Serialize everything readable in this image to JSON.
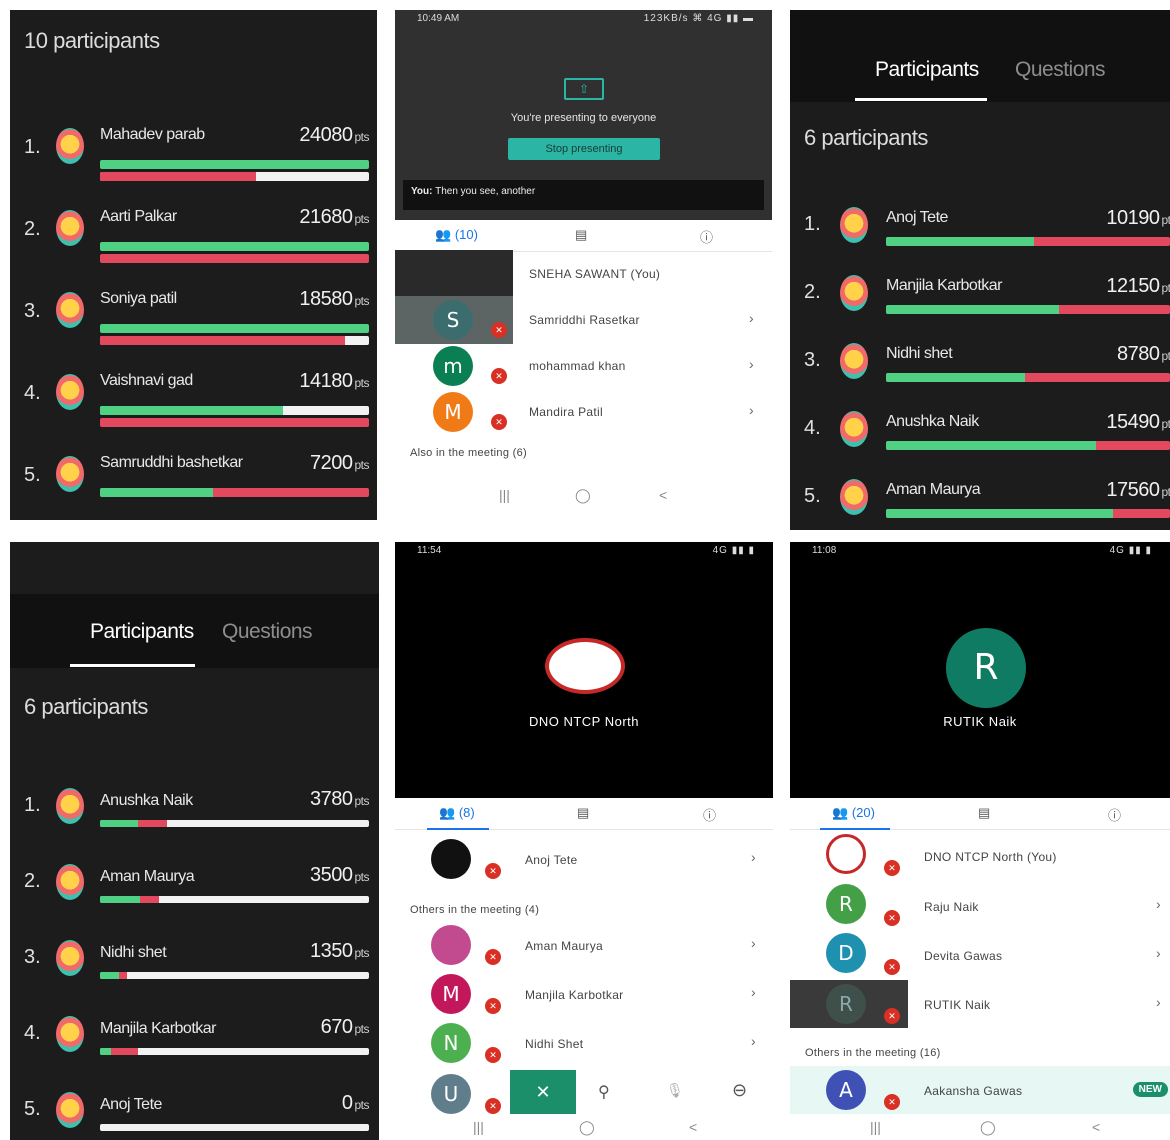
{
  "panel1": {
    "title": "10 participants",
    "pts": "pts",
    "rows": [
      {
        "rank": "1.",
        "name": "Mahadev parab",
        "score": "24080"
      },
      {
        "rank": "2.",
        "name": "Aarti Palkar",
        "score": "21680"
      },
      {
        "rank": "3.",
        "name": "Soniya patil",
        "score": "18580"
      },
      {
        "rank": "4.",
        "name": "Vaishnavi gad",
        "score": "14180"
      },
      {
        "rank": "5.",
        "name": "Samruddhi bashetkar",
        "score": "7200"
      }
    ]
  },
  "panel2": {
    "status_time": "10:49 AM",
    "status_icons": "123KB/s ⌘ 4G ▮▮ ▬",
    "presenting_text": "You're presenting to everyone",
    "stop_button": "Stop presenting",
    "caption_speaker": "You:",
    "caption_text": "Then you see, another",
    "tab_people_count": "(10)",
    "participants": [
      {
        "name": "SNEHA SAWANT (You)",
        "initial": "",
        "color": "#333333"
      },
      {
        "name": "Samriddhi Rasetkar",
        "initial": "S",
        "color": "#3c6d6e"
      },
      {
        "name": "mohammad khan",
        "initial": "m",
        "color": "#0b7f54"
      },
      {
        "name": "Mandira Patil",
        "initial": "M",
        "color": "#f07b16"
      }
    ],
    "also_label": "Also in the meeting (6)",
    "nav": [
      "|||",
      "◯",
      "<"
    ]
  },
  "panel3": {
    "tabs": [
      "Participants",
      "Questions"
    ],
    "title": "6 participants",
    "pts": "pts",
    "rows": [
      {
        "rank": "1.",
        "name": "Anoj Tete",
        "score": "10190"
      },
      {
        "rank": "2.",
        "name": "Manjila Karbotkar",
        "score": "12150"
      },
      {
        "rank": "3.",
        "name": "Nidhi shet",
        "score": "8780"
      },
      {
        "rank": "4.",
        "name": "Anushka Naik",
        "score": "15490"
      },
      {
        "rank": "5.",
        "name": "Aman Maurya",
        "score": "17560"
      }
    ]
  },
  "panel4": {
    "tabs": [
      "Participants",
      "Questions"
    ],
    "title": "6 participants",
    "pts": "pts",
    "rows": [
      {
        "rank": "1.",
        "name": "Anushka Naik",
        "score": "3780"
      },
      {
        "rank": "2.",
        "name": "Aman Maurya",
        "score": "3500"
      },
      {
        "rank": "3.",
        "name": "Nidhi shet",
        "score": "1350"
      },
      {
        "rank": "4.",
        "name": "Manjila Karbotkar",
        "score": "670"
      },
      {
        "rank": "5.",
        "name": "Anoj Tete",
        "score": "0"
      }
    ]
  },
  "panel5": {
    "status_time": "11:54",
    "status_icons": "4G ▮▮ ▮",
    "presenter_name": "DNO NTCP North",
    "tab_people_count": "(8)",
    "first_row": {
      "name": "Anoj Tete"
    },
    "others_label": "Others in the meeting (4)",
    "participants": [
      {
        "name": "Aman Maurya",
        "initial": "",
        "color": "#c24a8f"
      },
      {
        "name": "Manjila Karbotkar",
        "initial": "M",
        "color": "#c2185b"
      },
      {
        "name": "Nidhi Shet",
        "initial": "N",
        "color": "#4caf50"
      },
      {
        "name": "",
        "initial": "U",
        "color": "#607d8b"
      }
    ],
    "controls": {
      "close": "✕",
      "pin": "⚲",
      "mute": "🎙",
      "remove": "⊖"
    },
    "nav": [
      "|||",
      "◯",
      "<"
    ]
  },
  "panel6": {
    "status_time": "11:08",
    "status_icons": "4G ▮▮ ▮",
    "presenter_initial": "R",
    "presenter_name": "RUTIK Naik",
    "tab_people_count": "(20)",
    "participants": [
      {
        "name": "DNO NTCP North (You)",
        "initial": "",
        "color": "#ffffff"
      },
      {
        "name": "Raju Naik",
        "initial": "R",
        "color": "#43a047"
      },
      {
        "name": "Devita Gawas",
        "initial": "D",
        "color": "#1e90b0"
      },
      {
        "name": "RUTIK Naik",
        "initial": "R",
        "color": "#3f4f4a"
      }
    ],
    "others_label": "Others in the meeting (16)",
    "new_row": {
      "name": "Aakansha Gawas",
      "initial": "A",
      "badge": "NEW"
    },
    "nav": [
      "|||",
      "◯",
      "<"
    ]
  }
}
